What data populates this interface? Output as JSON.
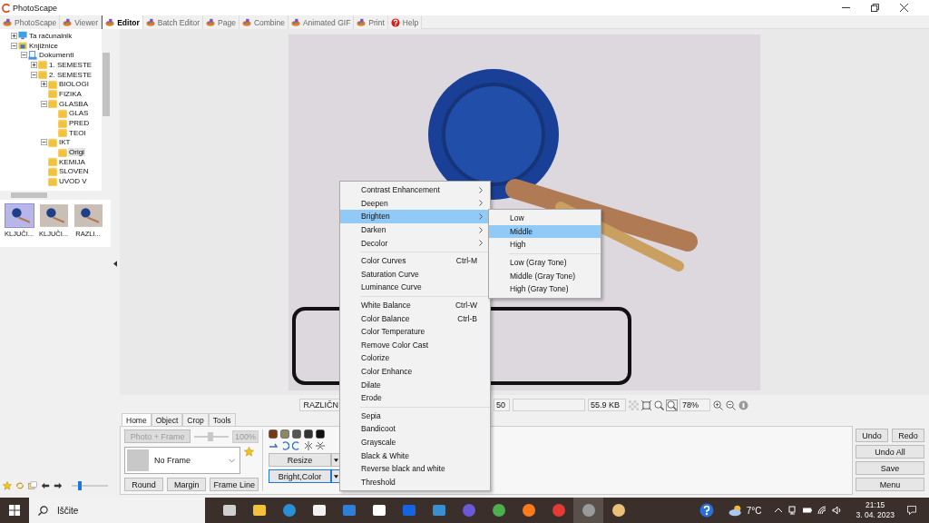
{
  "window": {
    "title": "PhotoScape"
  },
  "tabs": [
    {
      "label": "PhotoScape",
      "selected": false
    },
    {
      "label": "Viewer",
      "selected": false
    },
    {
      "label": "Editor",
      "selected": true
    },
    {
      "label": "Batch Editor",
      "selected": false
    },
    {
      "label": "Page",
      "selected": false
    },
    {
      "label": "Combine",
      "selected": false
    },
    {
      "label": "Animated GIF",
      "selected": false
    },
    {
      "label": "Print",
      "selected": false
    },
    {
      "label": "Help",
      "selected": false
    }
  ],
  "tree": [
    {
      "label": "Ta računalnik",
      "kind": "computer",
      "expanded": false,
      "selected": false
    },
    {
      "label": "Knjižnice",
      "kind": "library",
      "expanded": true,
      "selected": false,
      "children": [
        {
          "label": "Dokumenti",
          "kind": "documents",
          "expanded": true,
          "selected": false,
          "children": [
            {
              "label": "1. SEMESTE",
              "kind": "folder",
              "expanded": false,
              "selected": false
            },
            {
              "label": "2. SEMESTE",
              "kind": "folder",
              "expanded": true,
              "selected": false,
              "children": [
                {
                  "label": "BIOLOGI",
                  "kind": "folder",
                  "expanded": false,
                  "selected": false
                },
                {
                  "label": "FIZIKA",
                  "kind": "folder",
                  "selected": false
                },
                {
                  "label": "GLASBA",
                  "kind": "folder",
                  "expanded": true,
                  "selected": false,
                  "children": [
                    {
                      "label": "GLAS",
                      "kind": "folder",
                      "selected": false
                    },
                    {
                      "label": "PRED",
                      "kind": "folder",
                      "selected": false
                    },
                    {
                      "label": "TEOI",
                      "kind": "folder",
                      "selected": false
                    }
                  ]
                },
                {
                  "label": "IKT",
                  "kind": "folder",
                  "expanded": true,
                  "selected": false,
                  "children": [
                    {
                      "label": "Origi",
                      "kind": "folder",
                      "selected": true
                    }
                  ]
                },
                {
                  "label": "KEMIJA",
                  "kind": "folder",
                  "selected": false
                },
                {
                  "label": "SLOVEN",
                  "kind": "folder",
                  "selected": false
                },
                {
                  "label": "UVOD V",
                  "kind": "folder",
                  "selected": false
                }
              ]
            }
          ]
        }
      ]
    }
  ],
  "thumbnails": [
    {
      "label": "KLJUČI...",
      "selected": true
    },
    {
      "label": "KLJUČI...",
      "selected": false
    },
    {
      "label": "RAZLI...",
      "selected": false
    }
  ],
  "zoom_slider": {
    "level": 0.2
  },
  "status": {
    "name_field": "RAZLIČN",
    "field_2": "50",
    "size": "55.9 KB",
    "zoom": "78%"
  },
  "edit_tabs": [
    {
      "label": "Home",
      "selected": true
    },
    {
      "label": "Object",
      "selected": false
    },
    {
      "label": "Crop",
      "selected": false
    },
    {
      "label": "Tools",
      "selected": false
    }
  ],
  "photo_frame_button": {
    "label": "Photo + Frame",
    "disabled": true
  },
  "frame_scale": {
    "value": "100%",
    "level": 0.45,
    "disabled": true
  },
  "frame_dropdown": {
    "value": "No Frame"
  },
  "frame_buttons": [
    "Round",
    "Margin",
    "Frame Line"
  ],
  "tool_buttons": [
    {
      "label": "Resize",
      "focused": false
    },
    {
      "label": "Bright,Color",
      "focused": true
    }
  ],
  "side_buttons": [
    {
      "labels": [
        "Undo",
        "Redo"
      ]
    },
    {
      "labels": [
        "Undo All"
      ]
    },
    {
      "labels": [
        "Save"
      ]
    },
    {
      "labels": [
        "Menu"
      ]
    }
  ],
  "menu": {
    "groups": [
      [
        {
          "label": "Contrast Enhancement",
          "submenu": true,
          "selected": false
        },
        {
          "label": "Deepen",
          "submenu": true,
          "selected": false
        },
        {
          "label": "Brighten",
          "submenu": true,
          "selected": true
        },
        {
          "label": "Darken",
          "submenu": true,
          "selected": false
        },
        {
          "label": "Decolor",
          "submenu": true,
          "selected": false
        }
      ],
      [
        {
          "label": "Color Curves",
          "shortcut": "Ctrl-M",
          "selected": false
        },
        {
          "label": "Saturation Curve",
          "selected": false
        },
        {
          "label": "Luminance Curve",
          "selected": false
        }
      ],
      [
        {
          "label": "White Balance",
          "shortcut": "Ctrl-W",
          "selected": false
        },
        {
          "label": "Color Balance",
          "shortcut": "Ctrl-B",
          "selected": false
        },
        {
          "label": "Color Temperature",
          "selected": false
        },
        {
          "label": "Remove Color Cast",
          "selected": false
        },
        {
          "label": "Colorize",
          "selected": false
        },
        {
          "label": "Color Enhance",
          "selected": false
        },
        {
          "label": "Dilate",
          "selected": false
        },
        {
          "label": "Erode",
          "selected": false
        }
      ],
      [
        {
          "label": "Sepia",
          "selected": false
        },
        {
          "label": "Bandicoot",
          "selected": false
        },
        {
          "label": "Grayscale",
          "selected": false
        },
        {
          "label": "Black & White",
          "selected": false
        },
        {
          "label": "Reverse black and white",
          "selected": false
        },
        {
          "label": "Threshold",
          "selected": false
        }
      ]
    ]
  },
  "submenu": {
    "groups": [
      [
        {
          "label": "Low",
          "selected": false
        },
        {
          "label": "Middle",
          "selected": true
        },
        {
          "label": "High",
          "selected": false
        }
      ],
      [
        {
          "label": "Low (Gray Tone)",
          "selected": false
        },
        {
          "label": "Middle (Gray Tone)",
          "selected": false
        },
        {
          "label": "High (Gray Tone)",
          "selected": false
        }
      ]
    ]
  },
  "taskbar": {
    "search_placeholder": "Iščite",
    "weather": "7°C",
    "time": "21:15",
    "date": "3. 04. 2023"
  }
}
